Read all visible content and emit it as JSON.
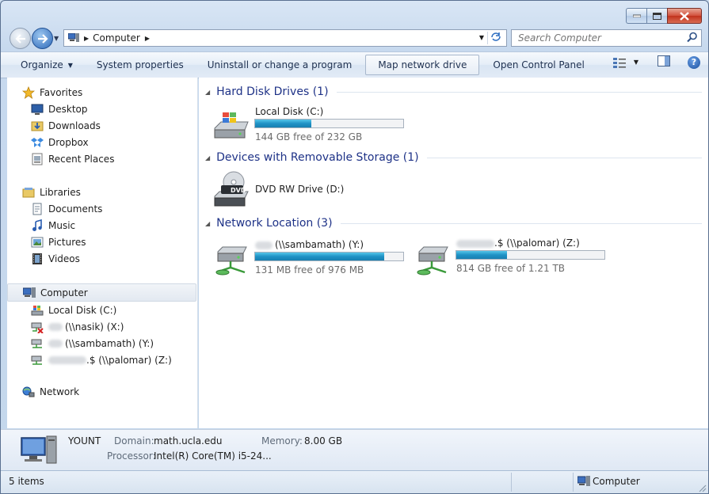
{
  "window": {
    "controls": {
      "minimize": "minimize",
      "maximize": "maximize",
      "close": "close"
    }
  },
  "address_bar": {
    "crumb": "Computer"
  },
  "search": {
    "placeholder": "Search Computer"
  },
  "toolbar": {
    "organize": "Organize",
    "system_properties": "System properties",
    "uninstall": "Uninstall or change a program",
    "map_drive": "Map network drive",
    "control_panel": "Open Control Panel"
  },
  "nav": {
    "favorites": {
      "label": "Favorites",
      "items": [
        "Desktop",
        "Downloads",
        "Dropbox",
        "Recent Places"
      ]
    },
    "libraries": {
      "label": "Libraries",
      "items": [
        "Documents",
        "Music",
        "Pictures",
        "Videos"
      ]
    },
    "computer": {
      "label": "Computer",
      "items": [
        "Local Disk (C:)",
        "(\\\\nasik) (X:)",
        "(\\\\sambamath) (Y:)",
        ".$ (\\\\palomar) (Z:)"
      ]
    },
    "network": {
      "label": "Network"
    }
  },
  "groups": {
    "hdd": "Hard Disk Drives (1)",
    "removable": "Devices with Removable Storage (1)",
    "network": "Network Location (3)"
  },
  "drives": {
    "c": {
      "name": "Local Disk (C:)",
      "free": "144 GB free of 232 GB",
      "used_fraction": 0.38
    },
    "d": {
      "name": "DVD RW Drive (D:)",
      "badge": "DVD"
    },
    "y": {
      "name": "(\\\\sambamath) (Y:)",
      "free": "131 MB free of 976 MB",
      "used_fraction": 0.87
    },
    "z": {
      "name": ".$ (\\\\palomar) (Z:)",
      "free": "814 GB free of 1.21 TB",
      "used_fraction": 0.34
    }
  },
  "details": {
    "name": "YOUNT",
    "domain_label": "Domain:",
    "domain": "math.ucla.edu",
    "memory_label": "Memory:",
    "memory": "8.00 GB",
    "processor_label": "Processor:",
    "processor": "Intel(R) Core(TM) i5-24..."
  },
  "status": {
    "items": "5 items",
    "location": "Computer"
  },
  "colors": {
    "accent": "#1e3287",
    "bar_fill": "#1f92c5",
    "window_frame": "#c7d9ee"
  }
}
